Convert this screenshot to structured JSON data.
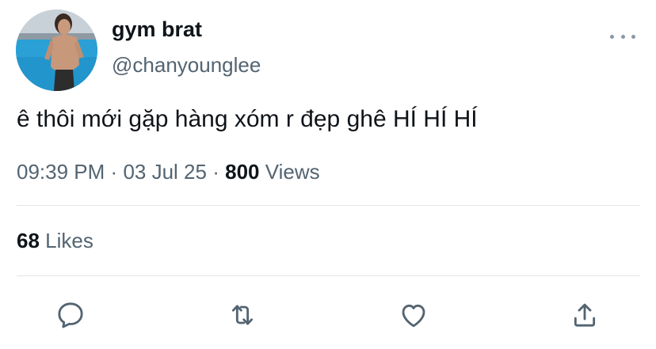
{
  "user": {
    "display_name": "gym brat",
    "handle": "@chanyounglee"
  },
  "tweet": {
    "text": "ê thôi mới gặp hàng xóm r đẹp ghê HÍ HÍ HÍ",
    "time": "09:39 PM",
    "date": "03 Jul 25",
    "views_count": "800",
    "views_label": "Views",
    "separator": "·"
  },
  "stats": {
    "likes_count": "68",
    "likes_label": "Likes"
  },
  "icons": {
    "more": "more-horizontal-icon",
    "reply": "reply-icon",
    "retweet": "retweet-icon",
    "like": "heart-icon",
    "share": "share-icon"
  },
  "colors": {
    "text_primary": "#0f1419",
    "text_secondary": "#536471",
    "icon": "#536471",
    "divider": "#e1e5e8"
  }
}
